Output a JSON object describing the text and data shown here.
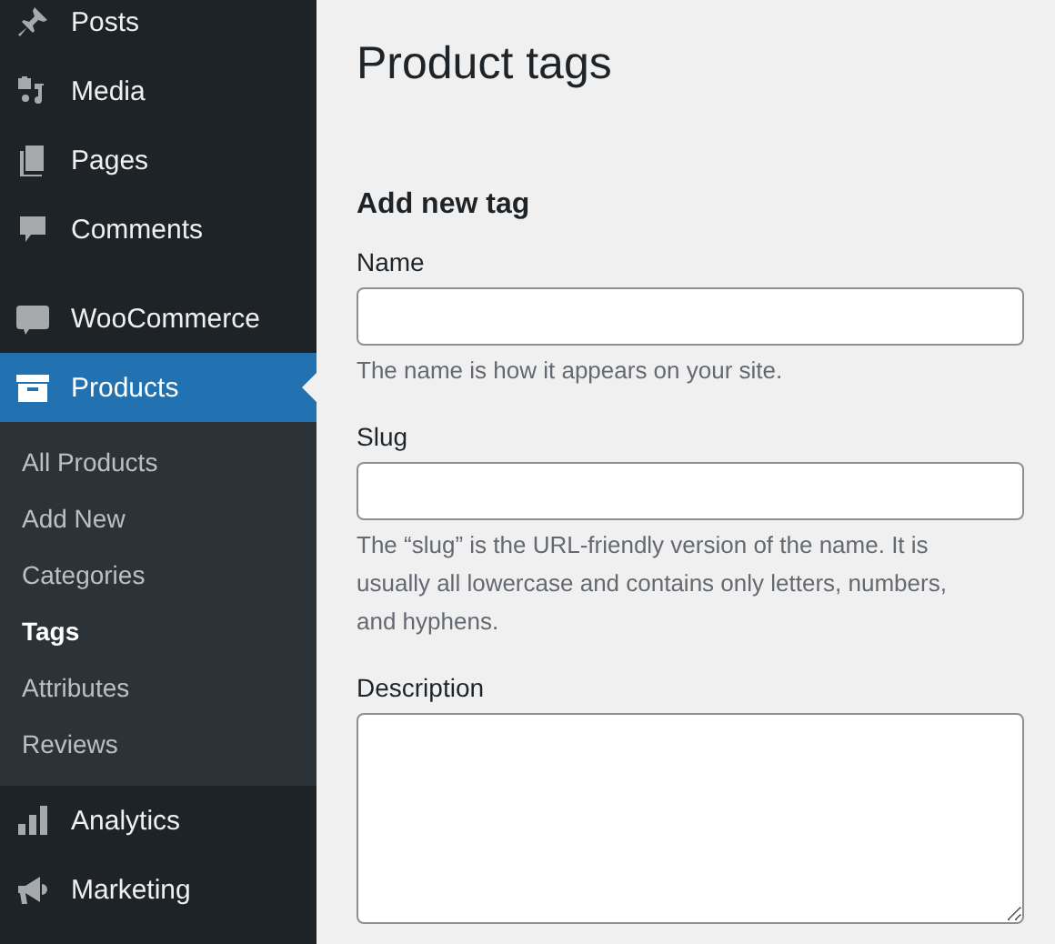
{
  "sidebar": {
    "items": [
      {
        "label": "Posts",
        "selected": false
      },
      {
        "label": "Media",
        "selected": false
      },
      {
        "label": "Pages",
        "selected": false
      },
      {
        "label": "Comments",
        "selected": false
      },
      {
        "label": "WooCommerce",
        "selected": false
      },
      {
        "label": "Products",
        "selected": true,
        "children": [
          {
            "label": "All Products",
            "selected": false
          },
          {
            "label": "Add New",
            "selected": false
          },
          {
            "label": "Categories",
            "selected": false
          },
          {
            "label": "Tags",
            "selected": true
          },
          {
            "label": "Attributes",
            "selected": false
          },
          {
            "label": "Reviews",
            "selected": false
          }
        ]
      },
      {
        "label": "Analytics",
        "selected": false
      },
      {
        "label": "Marketing",
        "selected": false
      }
    ]
  },
  "page_title": "Product tags",
  "form": {
    "heading": "Add new tag",
    "fields": [
      {
        "kind": "input",
        "label": "Name",
        "help": "The name is how it appears on your site."
      },
      {
        "kind": "input",
        "label": "Slug",
        "help": "The “slug” is the URL-friendly version of the name. It is usually all lowercase and contains only letters, numbers, and hyphens."
      },
      {
        "kind": "textarea",
        "label": "Description"
      }
    ]
  }
}
